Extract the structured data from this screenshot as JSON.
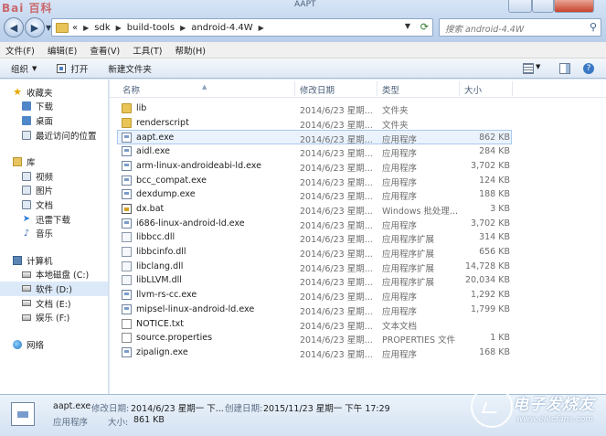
{
  "window": {
    "watermark": "Bai 百科",
    "title": "AAPT"
  },
  "address": {
    "prefix": "«",
    "crumbs": [
      "sdk",
      "build-tools",
      "android-4.4W"
    ]
  },
  "search": {
    "placeholder": "搜索 android-4.4W"
  },
  "menu": [
    "文件(F)",
    "编辑(E)",
    "查看(V)",
    "工具(T)",
    "帮助(H)"
  ],
  "toolbar": {
    "organize": "组织",
    "open": "打开",
    "new_folder": "新建文件夹"
  },
  "sidebar": {
    "favorites": {
      "label": "收藏夹",
      "items": [
        "下载",
        "桌面",
        "最近访问的位置"
      ]
    },
    "libraries": {
      "label": "库",
      "items": [
        "视频",
        "图片",
        "文档",
        "迅雷下载",
        "音乐"
      ]
    },
    "computer": {
      "label": "计算机",
      "items": [
        "本地磁盘 (C:)",
        "软件 (D:)",
        "文档 (E:)",
        "娱乐 (F:)"
      ]
    },
    "network": {
      "label": "网络"
    }
  },
  "columns": {
    "name": "名称",
    "date": "修改日期",
    "type": "类型",
    "size": "大小"
  },
  "files": [
    {
      "name": "lib",
      "date": "2014/6/23 星期...",
      "type": "文件夹",
      "size": "",
      "icon": "folder"
    },
    {
      "name": "renderscript",
      "date": "2014/6/23 星期...",
      "type": "文件夹",
      "size": "",
      "icon": "folder"
    },
    {
      "name": "aapt.exe",
      "date": "2014/6/23 星期...",
      "type": "应用程序",
      "size": "862 KB",
      "icon": "exe"
    },
    {
      "name": "aidl.exe",
      "date": "2014/6/23 星期...",
      "type": "应用程序",
      "size": "284 KB",
      "icon": "exe"
    },
    {
      "name": "arm-linux-androideabi-ld.exe",
      "date": "2014/6/23 星期...",
      "type": "应用程序",
      "size": "3,702 KB",
      "icon": "exe"
    },
    {
      "name": "bcc_compat.exe",
      "date": "2014/6/23 星期...",
      "type": "应用程序",
      "size": "124 KB",
      "icon": "exe"
    },
    {
      "name": "dexdump.exe",
      "date": "2014/6/23 星期...",
      "type": "应用程序",
      "size": "188 KB",
      "icon": "exe"
    },
    {
      "name": "dx.bat",
      "date": "2014/6/23 星期...",
      "type": "Windows 批处理...",
      "size": "3 KB",
      "icon": "bat"
    },
    {
      "name": "i686-linux-android-ld.exe",
      "date": "2014/6/23 星期...",
      "type": "应用程序",
      "size": "3,702 KB",
      "icon": "exe"
    },
    {
      "name": "libbcc.dll",
      "date": "2014/6/23 星期...",
      "type": "应用程序扩展",
      "size": "314 KB",
      "icon": "dll"
    },
    {
      "name": "libbcinfo.dll",
      "date": "2014/6/23 星期...",
      "type": "应用程序扩展",
      "size": "656 KB",
      "icon": "dll"
    },
    {
      "name": "libclang.dll",
      "date": "2014/6/23 星期...",
      "type": "应用程序扩展",
      "size": "14,728 KB",
      "icon": "dll"
    },
    {
      "name": "libLLVM.dll",
      "date": "2014/6/23 星期...",
      "type": "应用程序扩展",
      "size": "20,034 KB",
      "icon": "dll"
    },
    {
      "name": "llvm-rs-cc.exe",
      "date": "2014/6/23 星期...",
      "type": "应用程序",
      "size": "1,292 KB",
      "icon": "exe"
    },
    {
      "name": "mipsel-linux-android-ld.exe",
      "date": "2014/6/23 星期...",
      "type": "应用程序",
      "size": "1,799 KB",
      "icon": "exe"
    },
    {
      "name": "NOTICE.txt",
      "date": "2014/6/23 星期...",
      "type": "文本文档",
      "size": "",
      "icon": "doc"
    },
    {
      "name": "source.properties",
      "date": "2014/6/23 星期...",
      "type": "PROPERTIES 文件",
      "size": "1 KB",
      "icon": "doc"
    },
    {
      "name": "zipalign.exe",
      "date": "2014/6/23 星期...",
      "type": "应用程序",
      "size": "168 KB",
      "icon": "exe"
    }
  ],
  "selected_index": 2,
  "details": {
    "filename": "aapt.exe",
    "modified_label": "修改日期:",
    "modified_value": "2014/6/23 星期一 下...",
    "created_label": "创建日期:",
    "created_value": "2015/11/23 星期一 下午 17:29",
    "type_value": "应用程序",
    "size_label": "大小:",
    "size_value": "861 KB"
  },
  "logo": {
    "name": "电子发烧友",
    "url": "www.elecfans.com"
  }
}
